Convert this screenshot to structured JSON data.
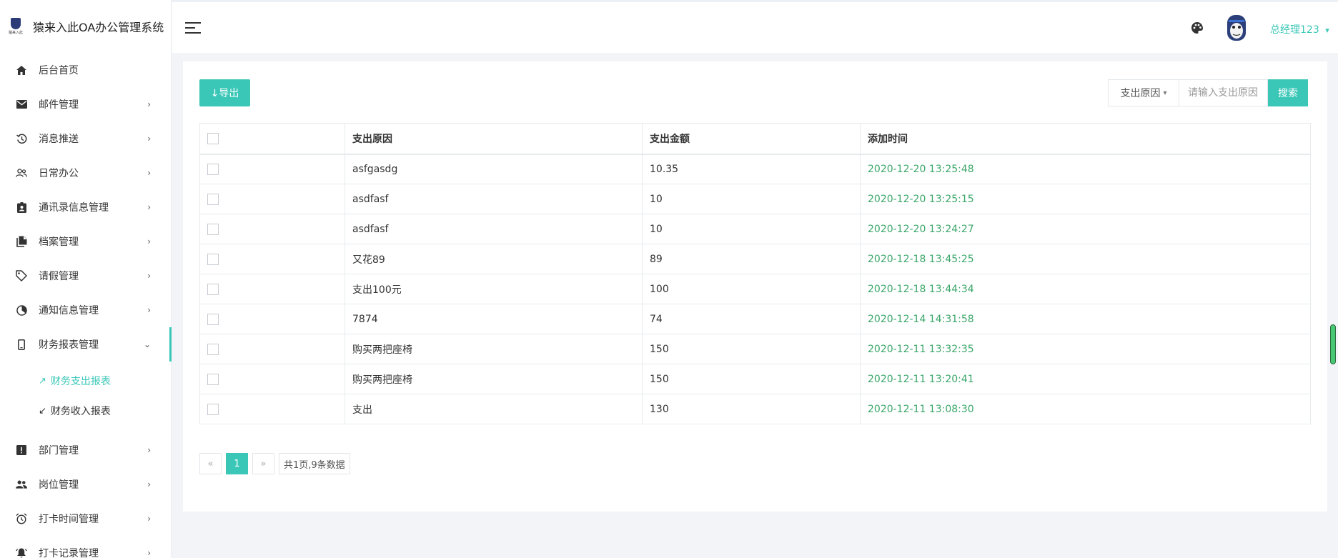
{
  "app": {
    "title": "猿来入此OA办公管理系统",
    "logo_text": "猿来入此"
  },
  "sidebar": {
    "items": [
      {
        "label": "后台首页",
        "icon": "home-icon"
      },
      {
        "label": "邮件管理",
        "icon": "mail-icon",
        "arrow": "›"
      },
      {
        "label": "消息推送",
        "icon": "history-icon",
        "arrow": "›"
      },
      {
        "label": "日常办公",
        "icon": "users-icon",
        "arrow": "›"
      },
      {
        "label": "通讯录信息管理",
        "icon": "contact-badge-icon",
        "arrow": "›"
      },
      {
        "label": "档案管理",
        "icon": "file-copy-icon",
        "arrow": "›"
      },
      {
        "label": "请假管理",
        "icon": "tag-icon",
        "arrow": "›"
      },
      {
        "label": "通知信息管理",
        "icon": "pie-icon",
        "arrow": "›"
      },
      {
        "label": "财务报表管理",
        "icon": "phone-icon",
        "arrow": "⌄"
      }
    ],
    "sub_items": [
      {
        "label": "财务支出报表",
        "symbol": "↗"
      },
      {
        "label": "财务收入报表",
        "symbol": "↙"
      }
    ],
    "items_after": [
      {
        "label": "部门管理",
        "icon": "alert-box-icon",
        "arrow": "›"
      },
      {
        "label": "岗位管理",
        "icon": "group-icon",
        "arrow": "›"
      },
      {
        "label": "打卡时间管理",
        "icon": "alarm-icon",
        "arrow": "›"
      },
      {
        "label": "打卡记录管理",
        "icon": "bell-icon",
        "arrow": "›"
      }
    ]
  },
  "topbar": {
    "user_name": "总经理123",
    "user_caret": "▾"
  },
  "toolbar": {
    "export_label": "↓导出",
    "search_field_label": "支出原因",
    "search_caret": "▾",
    "search_placeholder": "请输入支出原因",
    "search_button": "搜索"
  },
  "table": {
    "columns": [
      "支出原因",
      "支出金额",
      "添加时间"
    ],
    "rows": [
      {
        "reason": "asfgasdg",
        "amount": "10.35",
        "time": "2020-12-20 13:25:48"
      },
      {
        "reason": "asdfasf",
        "amount": "10",
        "time": "2020-12-20 13:25:15"
      },
      {
        "reason": "asdfasf",
        "amount": "10",
        "time": "2020-12-20 13:24:27"
      },
      {
        "reason": "又花89",
        "amount": "89",
        "time": "2020-12-18 13:45:25"
      },
      {
        "reason": "支出100元",
        "amount": "100",
        "time": "2020-12-18 13:44:34"
      },
      {
        "reason": "7874",
        "amount": "74",
        "time": "2020-12-14 14:31:58"
      },
      {
        "reason": "购买两把座椅",
        "amount": "150",
        "time": "2020-12-11 13:32:35"
      },
      {
        "reason": "购买两把座椅",
        "amount": "150",
        "time": "2020-12-11 13:20:41"
      },
      {
        "reason": "支出",
        "amount": "130",
        "time": "2020-12-11 13:08:30"
      }
    ]
  },
  "pagination": {
    "prev": "«",
    "current": "1",
    "next": "»",
    "info": "共1页,9条数据"
  },
  "colors": {
    "accent": "#3ac7b7",
    "time_text": "#3ba76a"
  }
}
